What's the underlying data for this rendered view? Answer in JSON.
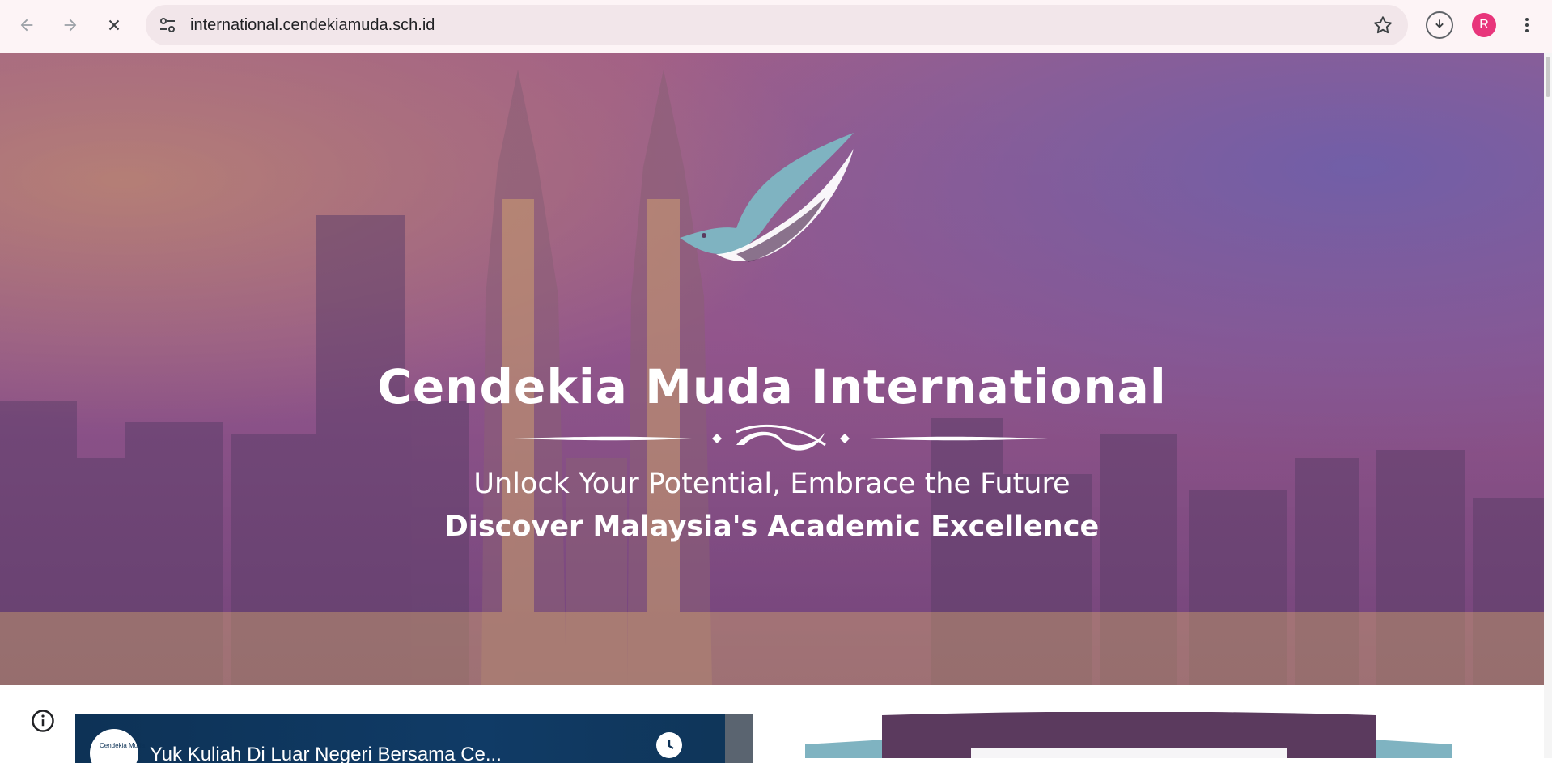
{
  "browser": {
    "url": "international.cendekiamuda.sch.id",
    "profile_initial": "R",
    "icons": [
      "back-icon",
      "forward-icon",
      "stop-loading-icon",
      "site-settings-icon",
      "bookmark-star-icon",
      "download-icon",
      "more-menu-icon"
    ]
  },
  "hero": {
    "title": "Cendekia Muda International",
    "subtitle": "Unlock Your Potential, Embrace the Future",
    "tagline": "Discover Malaysia's Academic Excellence"
  },
  "video": {
    "title": "Yuk Kuliah Di Luar Negeri Bersama Ce...",
    "channel_logo_text": "Cendekia Muda"
  },
  "colors": {
    "chrome_bg": "#fdf4f6",
    "omnibox_bg": "#f2e6ea",
    "avatar": "#e8357b",
    "hero_overlay": "#8a4f8c",
    "logo_teal": "#7fb3c1",
    "banner_purple": "#5b3a5e"
  }
}
